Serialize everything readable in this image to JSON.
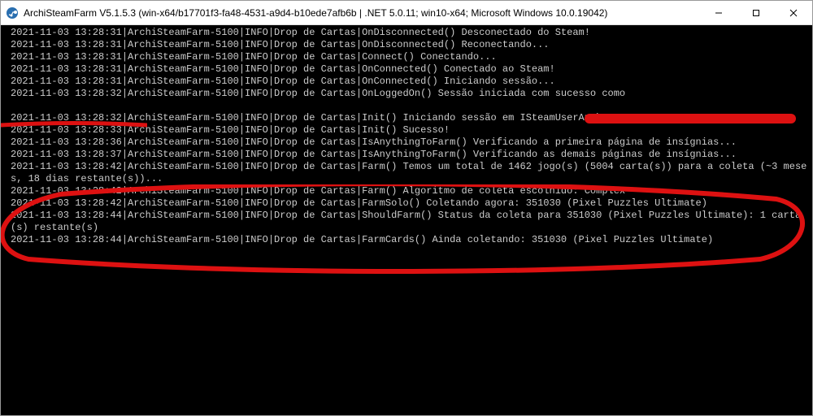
{
  "window": {
    "title": "ArchiSteamFarm V5.1.5.3 (win-x64/b17701f3-fa48-4531-a9d4-b10ede7afb6b | .NET 5.0.11; win10-x64; Microsoft Windows 10.0.19042)"
  },
  "console": {
    "lines": [
      "2021-11-03 13:28:31|ArchiSteamFarm-5100|INFO|Drop de Cartas|OnDisconnected() Desconectado do Steam!",
      "2021-11-03 13:28:31|ArchiSteamFarm-5100|INFO|Drop de Cartas|OnDisconnected() Reconectando...",
      "2021-11-03 13:28:31|ArchiSteamFarm-5100|INFO|Drop de Cartas|Connect() Conectando...",
      "2021-11-03 13:28:31|ArchiSteamFarm-5100|INFO|Drop de Cartas|OnConnected() Conectado ao Steam!",
      "2021-11-03 13:28:31|ArchiSteamFarm-5100|INFO|Drop de Cartas|OnConnected() Iniciando sessão...",
      "2021-11-03 13:28:32|ArchiSteamFarm-5100|INFO|Drop de Cartas|OnLoggedOn() Sessão iniciada com sucesso como",
      "",
      "2021-11-03 13:28:32|ArchiSteamFarm-5100|INFO|Drop de Cartas|Init() Iniciando sessão em ISteamUserAuth...",
      "2021-11-03 13:28:33|ArchiSteamFarm-5100|INFO|Drop de Cartas|Init() Sucesso!",
      "2021-11-03 13:28:36|ArchiSteamFarm-5100|INFO|Drop de Cartas|IsAnythingToFarm() Verificando a primeira página de insígnias...",
      "2021-11-03 13:28:37|ArchiSteamFarm-5100|INFO|Drop de Cartas|IsAnythingToFarm() Verificando as demais páginas de insígnias...",
      "2021-11-03 13:28:42|ArchiSteamFarm-5100|INFO|Drop de Cartas|Farm() Temos um total de 1462 jogo(s) (5004 carta(s)) para a coleta (~3 meses, 18 dias restante(s))...",
      "2021-11-03 13:28:42|ArchiSteamFarm-5100|INFO|Drop de Cartas|Farm() Algoritmo de coleta escolhido: Complex",
      "2021-11-03 13:28:42|ArchiSteamFarm-5100|INFO|Drop de Cartas|FarmSolo() Coletando agora: 351030 (Pixel Puzzles Ultimate)",
      "2021-11-03 13:28:44|ArchiSteamFarm-5100|INFO|Drop de Cartas|ShouldFarm() Status da coleta para 351030 (Pixel Puzzles Ultimate): 1 carta(s) restante(s)",
      "2021-11-03 13:28:44|ArchiSteamFarm-5100|INFO|Drop de Cartas|FarmCards() Ainda coletando: 351030 (Pixel Puzzles Ultimate)"
    ]
  }
}
